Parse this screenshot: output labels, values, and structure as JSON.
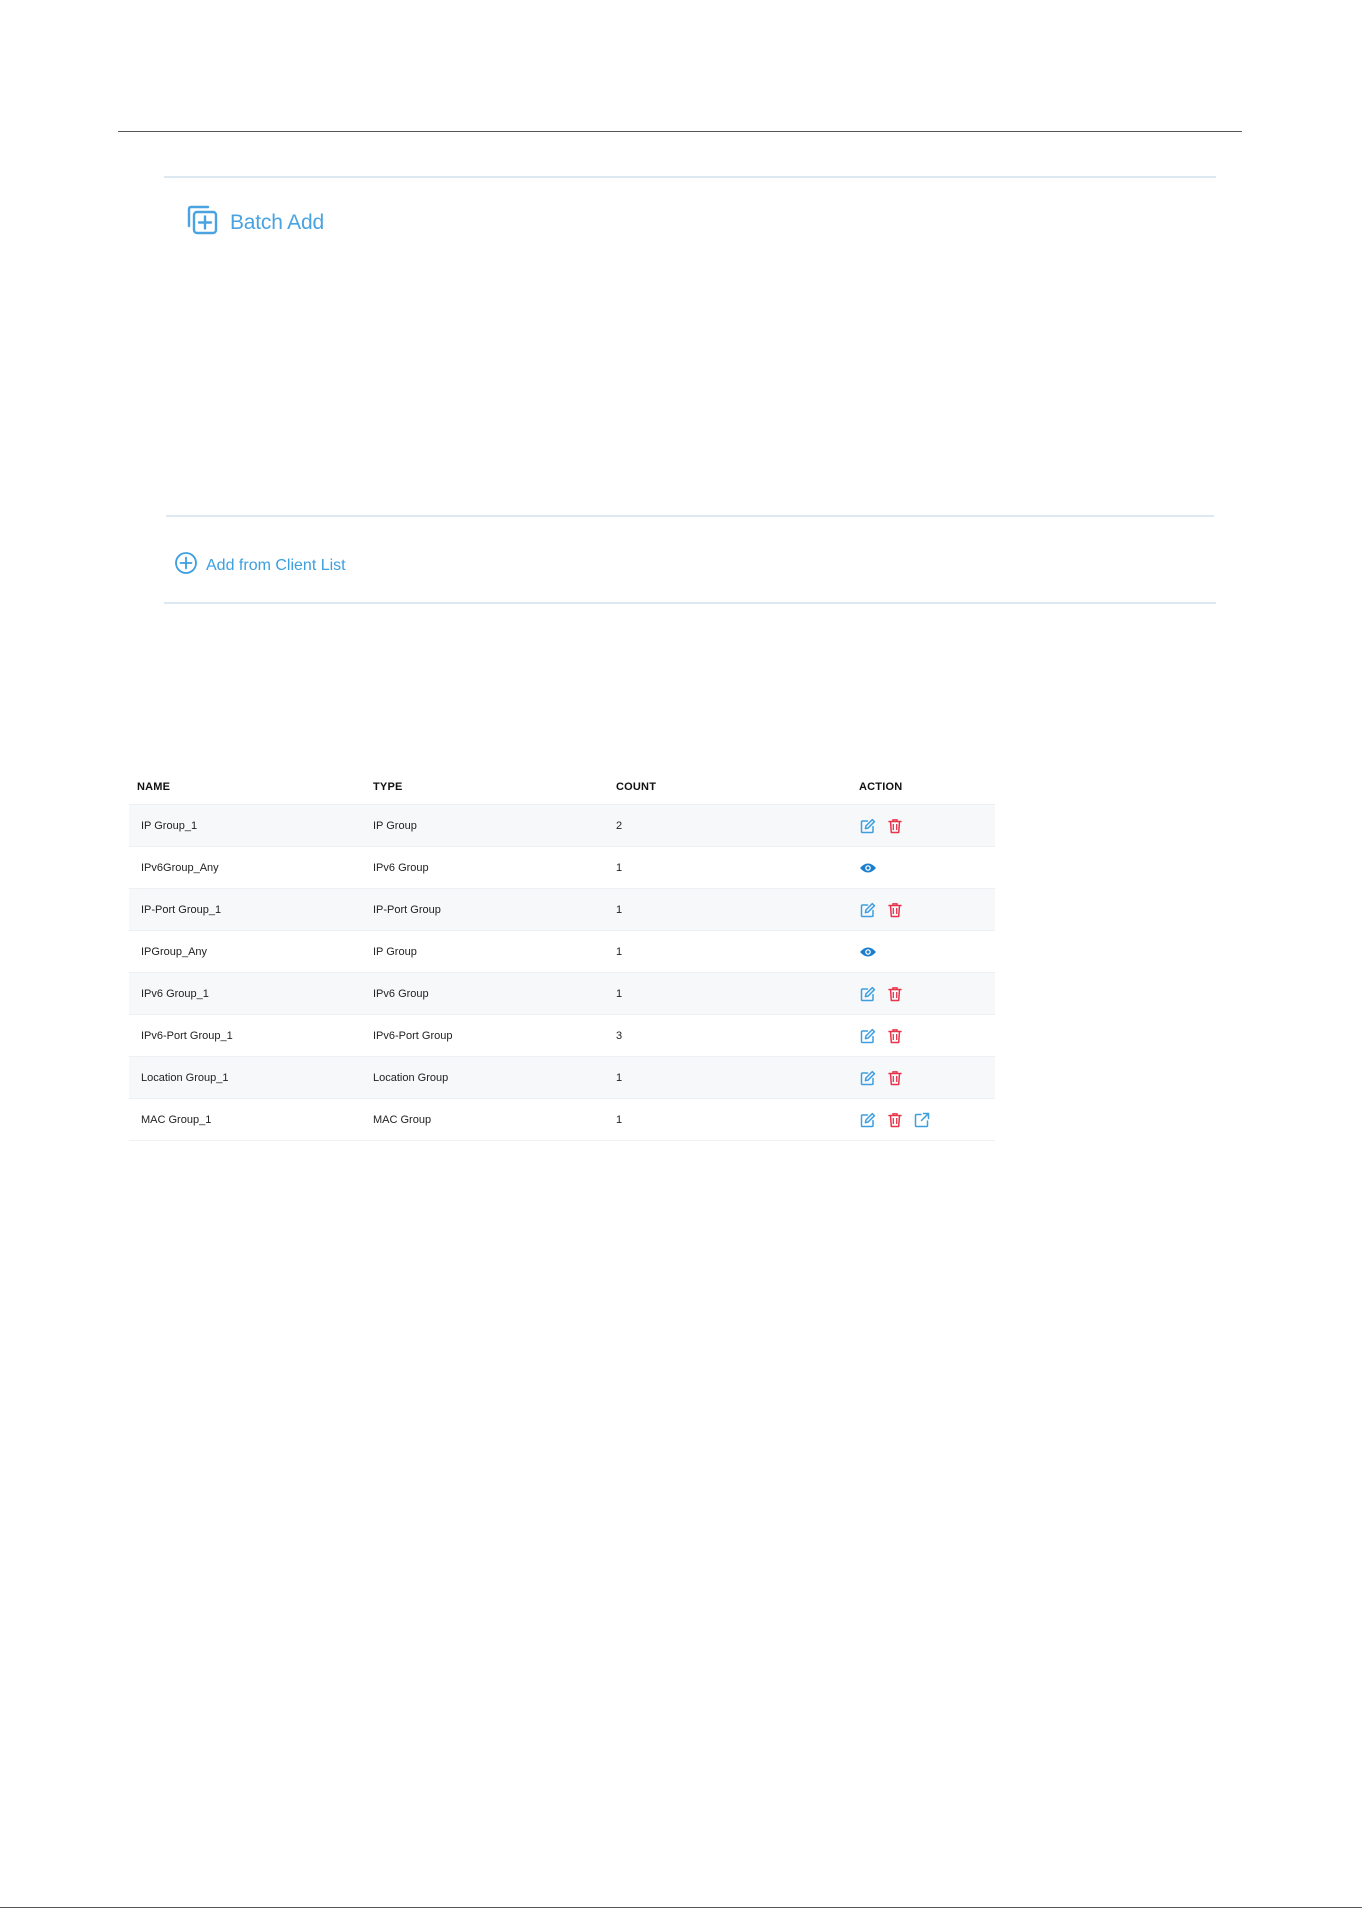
{
  "actions": {
    "batch_add_label": "Batch Add",
    "add_from_client_list_label": "Add from Client List"
  },
  "colors": {
    "accent": "#3b9fe0",
    "delete": "#e8334a",
    "view": "#1a7fd0"
  },
  "table": {
    "columns": [
      "NAME",
      "TYPE",
      "COUNT",
      "ACTION"
    ],
    "rows": [
      {
        "name": "IP Group_1",
        "type": "IP Group",
        "count": "2",
        "actions": [
          "edit-icon",
          "delete-icon"
        ]
      },
      {
        "name": "IPv6Group_Any",
        "type": "IPv6 Group",
        "count": "1",
        "actions": [
          "view-icon"
        ]
      },
      {
        "name": "IP-Port Group_1",
        "type": "IP-Port Group",
        "count": "1",
        "actions": [
          "edit-icon",
          "delete-icon"
        ]
      },
      {
        "name": "IPGroup_Any",
        "type": "IP Group",
        "count": "1",
        "actions": [
          "view-icon"
        ]
      },
      {
        "name": "IPv6 Group_1",
        "type": "IPv6 Group",
        "count": "1",
        "actions": [
          "edit-icon",
          "delete-icon"
        ]
      },
      {
        "name": "IPv6-Port Group_1",
        "type": "IPv6-Port Group",
        "count": "3",
        "actions": [
          "edit-icon",
          "delete-icon"
        ]
      },
      {
        "name": "Location Group_1",
        "type": "Location Group",
        "count": "1",
        "actions": [
          "edit-icon",
          "delete-icon"
        ]
      },
      {
        "name": "MAC Group_1",
        "type": "MAC Group",
        "count": "1",
        "actions": [
          "edit-icon",
          "delete-icon",
          "export-icon"
        ]
      }
    ]
  }
}
